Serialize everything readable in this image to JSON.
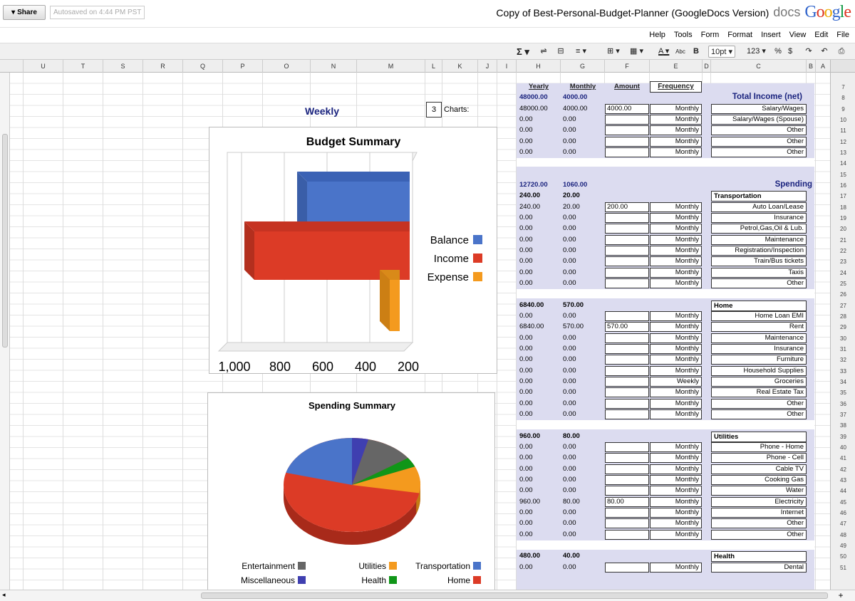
{
  "header": {
    "logo_letters": [
      "G",
      "o",
      "o",
      "g",
      "l",
      "e"
    ],
    "product": "docs",
    "doc_title": "Copy of Best-Personal-Budget-Planner (GoogleDocs Version)",
    "share_label": "Share",
    "autosave": "Autosaved on 4:44 PM PST"
  },
  "menu": [
    "File",
    "Edit",
    "View",
    "Insert",
    "Format",
    "Form",
    "Tools",
    "Help"
  ],
  "toolbar": {
    "currency": "$",
    "percent": "%",
    "number_format": "123",
    "font_size": "10pt",
    "bold": "B",
    "strike": "Abc",
    "sum": "Σ",
    "text_color": "A"
  },
  "columns": [
    "A",
    "B",
    "C",
    "D",
    "E",
    "F",
    "G",
    "H",
    "I",
    "J",
    "K",
    "L",
    "M",
    "N",
    "O",
    "P",
    "Q",
    "R",
    "S",
    "T",
    "U"
  ],
  "rows": [
    "7",
    "8",
    "9",
    "10",
    "11",
    "12",
    "13",
    "14",
    "15",
    "16",
    "17",
    "18",
    "19",
    "20",
    "21",
    "22",
    "23",
    "24",
    "25",
    "26",
    "27",
    "28",
    "29",
    "30",
    "31",
    "32",
    "33",
    "34",
    "35",
    "36",
    "37",
    "38",
    "39",
    "40",
    "41",
    "42",
    "43",
    "44",
    "45",
    "46",
    "47",
    "48",
    "49",
    "50",
    "51"
  ],
  "sheet": {
    "headers": {
      "frequency": "Frequency",
      "amount": "Amount",
      "monthly": "Monthly",
      "yearly": "Yearly"
    },
    "charts_label": "Charts:",
    "charts_value": "3",
    "weekly_label": "Weekly",
    "income": {
      "title": "Total Income (net)",
      "monthly": "4000.00",
      "yearly": "48000.00",
      "rows": [
        {
          "name": "Salary/Wages",
          "freq": "Monthly",
          "amount": "4000.00",
          "monthly": "4000.00",
          "yearly": "48000.00"
        },
        {
          "name": "Salary/Wages (Spouse)",
          "freq": "Monthly",
          "amount": "",
          "monthly": "0.00",
          "yearly": "0.00"
        },
        {
          "name": "Other",
          "freq": "Monthly",
          "amount": "",
          "monthly": "0.00",
          "yearly": "0.00"
        },
        {
          "name": "Other",
          "freq": "Monthly",
          "amount": "",
          "monthly": "0.00",
          "yearly": "0.00"
        },
        {
          "name": "Other",
          "freq": "Monthly",
          "amount": "",
          "monthly": "0.00",
          "yearly": "0.00"
        }
      ]
    },
    "spending": {
      "title": "Spending",
      "monthly": "1060.00",
      "yearly": "12720.00"
    },
    "categories": [
      {
        "title": "Transportation",
        "monthly": "20.00",
        "yearly": "240.00",
        "row_start": 11,
        "rows": [
          {
            "name": "Auto Loan/Lease",
            "freq": "Monthly",
            "amount": "200.00",
            "monthly": "20.00",
            "yearly": "240.00"
          },
          {
            "name": "Insurance",
            "freq": "Monthly",
            "amount": "",
            "monthly": "0.00",
            "yearly": "0.00"
          },
          {
            "name": "Petrol,Gas,Oil & Lub.",
            "freq": "Monthly",
            "amount": "",
            "monthly": "0.00",
            "yearly": "0.00"
          },
          {
            "name": "Maintenance",
            "freq": "Monthly",
            "amount": "",
            "monthly": "0.00",
            "yearly": "0.00"
          },
          {
            "name": "Registration/Inspection",
            "freq": "Monthly",
            "amount": "",
            "monthly": "0.00",
            "yearly": "0.00"
          },
          {
            "name": "Train/Bus tickets",
            "freq": "Monthly",
            "amount": "",
            "monthly": "0.00",
            "yearly": "0.00"
          },
          {
            "name": "Taxis",
            "freq": "Monthly",
            "amount": "",
            "monthly": "0.00",
            "yearly": "0.00"
          },
          {
            "name": "Other",
            "freq": "Monthly",
            "amount": "",
            "monthly": "0.00",
            "yearly": "0.00"
          }
        ]
      },
      {
        "title": "Home",
        "monthly": "570.00",
        "yearly": "6840.00",
        "row_start": 21,
        "rows": [
          {
            "name": "Home Loan EMI",
            "freq": "Monthly",
            "amount": "",
            "monthly": "0.00",
            "yearly": "0.00"
          },
          {
            "name": "Rent",
            "freq": "Monthly",
            "amount": "570.00",
            "monthly": "570.00",
            "yearly": "6840.00"
          },
          {
            "name": "Maintenance",
            "freq": "Monthly",
            "amount": "",
            "monthly": "0.00",
            "yearly": "0.00"
          },
          {
            "name": "Insurance",
            "freq": "Monthly",
            "amount": "",
            "monthly": "0.00",
            "yearly": "0.00"
          },
          {
            "name": "Furniture",
            "freq": "Monthly",
            "amount": "",
            "monthly": "0.00",
            "yearly": "0.00"
          },
          {
            "name": "Household Supplies",
            "freq": "Monthly",
            "amount": "",
            "monthly": "0.00",
            "yearly": "0.00"
          },
          {
            "name": "Groceries",
            "freq": "Weekly",
            "amount": "",
            "monthly": "0.00",
            "yearly": "0.00"
          },
          {
            "name": "Real Estate Tax",
            "freq": "Monthly",
            "amount": "",
            "monthly": "0.00",
            "yearly": "0.00"
          },
          {
            "name": "Other",
            "freq": "Monthly",
            "amount": "",
            "monthly": "0.00",
            "yearly": "0.00"
          },
          {
            "name": "Other",
            "freq": "Monthly",
            "amount": "",
            "monthly": "0.00",
            "yearly": "0.00"
          }
        ]
      },
      {
        "title": "Utilities",
        "monthly": "80.00",
        "yearly": "960.00",
        "row_start": 33,
        "rows": [
          {
            "name": "Phone - Home",
            "freq": "Monthly",
            "amount": "",
            "monthly": "0.00",
            "yearly": "0.00"
          },
          {
            "name": "Phone - Cell",
            "freq": "Monthly",
            "amount": "",
            "monthly": "0.00",
            "yearly": "0.00"
          },
          {
            "name": "Cable TV",
            "freq": "Monthly",
            "amount": "",
            "monthly": "0.00",
            "yearly": "0.00"
          },
          {
            "name": "Cooking Gas",
            "freq": "Monthly",
            "amount": "",
            "monthly": "0.00",
            "yearly": "0.00"
          },
          {
            "name": "Water",
            "freq": "Monthly",
            "amount": "",
            "monthly": "0.00",
            "yearly": "0.00"
          },
          {
            "name": "Electricity",
            "freq": "Monthly",
            "amount": "80.00",
            "monthly": "80.00",
            "yearly": "960.00"
          },
          {
            "name": "Internet",
            "freq": "Monthly",
            "amount": "",
            "monthly": "0.00",
            "yearly": "0.00"
          },
          {
            "name": "Other",
            "freq": "Monthly",
            "amount": "",
            "monthly": "0.00",
            "yearly": "0.00"
          },
          {
            "name": "Other",
            "freq": "Monthly",
            "amount": "",
            "monthly": "0.00",
            "yearly": "0.00"
          }
        ]
      },
      {
        "title": "Health",
        "monthly": "40.00",
        "yearly": "480.00",
        "row_start": 44,
        "rows": [
          {
            "name": "Dental",
            "freq": "Monthly",
            "amount": "",
            "monthly": "0.00",
            "yearly": "0.00"
          }
        ]
      }
    ]
  },
  "chart_data": [
    {
      "type": "bar",
      "orientation": "horizontal",
      "title": "Budget Summary",
      "categories": [
        "Balance",
        "Income",
        "Expense"
      ],
      "colors": [
        "#4a74c9",
        "#dc3b26",
        "#f49a1e"
      ],
      "ticks": [
        "200",
        "400",
        "600",
        "800",
        "1,000"
      ]
    },
    {
      "type": "pie",
      "title": "Spending Summary",
      "categories": [
        "Home",
        "Transportation",
        "Health",
        "Utilities",
        "Miscellaneous",
        "Entertainment"
      ],
      "colors": [
        "#dc3b26",
        "#4a74c9",
        "#109618",
        "#f49a1e",
        "#3f3fb0",
        "#666666"
      ],
      "legend": [
        "Transportation",
        "Home",
        "Utilities",
        "Health",
        "Entertainment",
        "Miscellaneous"
      ],
      "legend_colors": [
        "#4a74c9",
        "#dc3b26",
        "#f49a1e",
        "#109618",
        "#666666",
        "#3f3fb0"
      ]
    }
  ]
}
